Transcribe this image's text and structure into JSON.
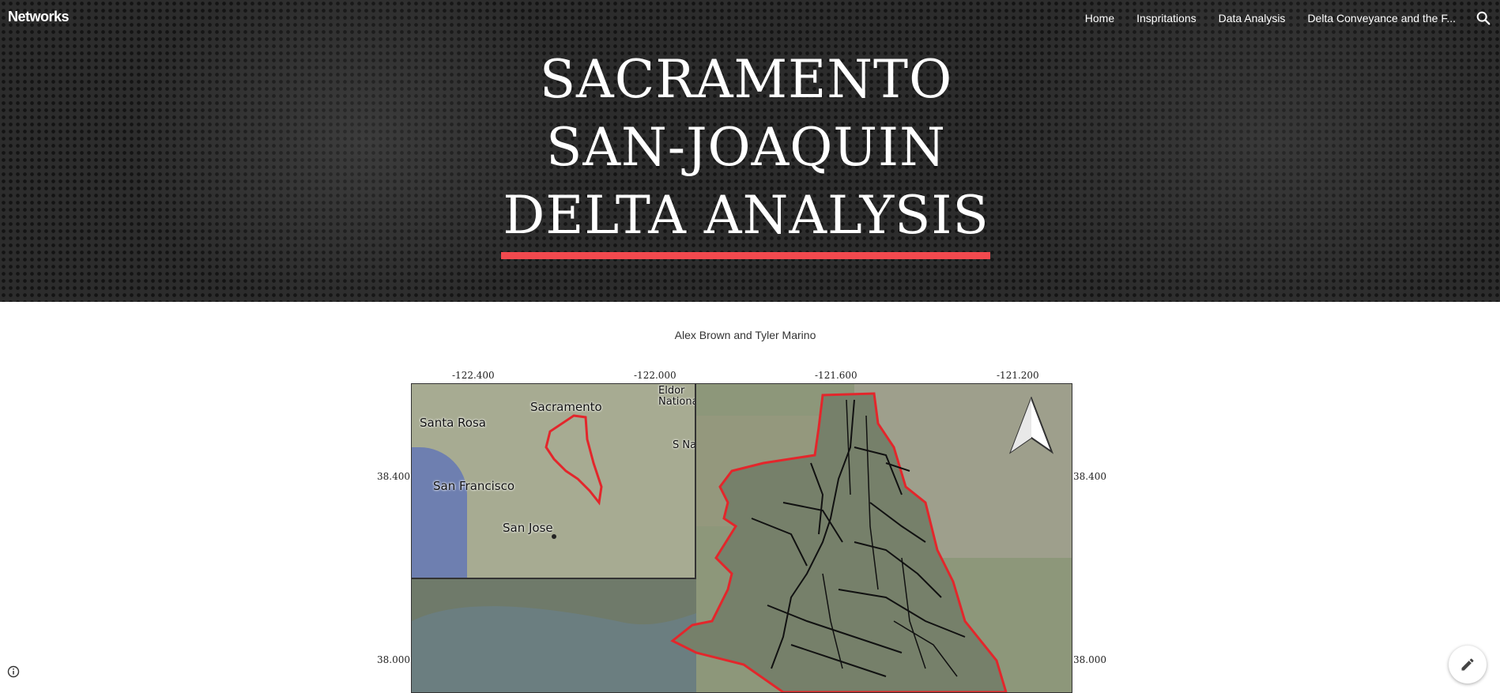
{
  "header": {
    "brand": "Networks",
    "nav": [
      "Home",
      "Inspritations",
      "Data Analysis",
      "Delta Conveyance and the F..."
    ],
    "search_icon": "search-icon"
  },
  "hero": {
    "title_lines": [
      "SACRAMENTO",
      "SAN-JOAQUIN",
      "DELTA ANALYSIS"
    ],
    "accent_color": "#f2494e"
  },
  "main": {
    "authors": "Alex Brown and Tyler Marino",
    "map": {
      "top_ticks": [
        "-122.400",
        "-122.000",
        "-121.600",
        "-121.200"
      ],
      "left_ticks": [
        "38.400",
        "38.000"
      ],
      "right_ticks": [
        "38.400",
        "38.000"
      ],
      "inset_labels": [
        "Sacramento",
        "Santa Rosa",
        "San Francisco",
        "San Jose",
        "Eldor National",
        "S Nat"
      ],
      "north_arrow_icon": "north-arrow-icon"
    }
  },
  "footer": {
    "info_icon": "info-icon",
    "edit_icon": "pencil-icon"
  }
}
